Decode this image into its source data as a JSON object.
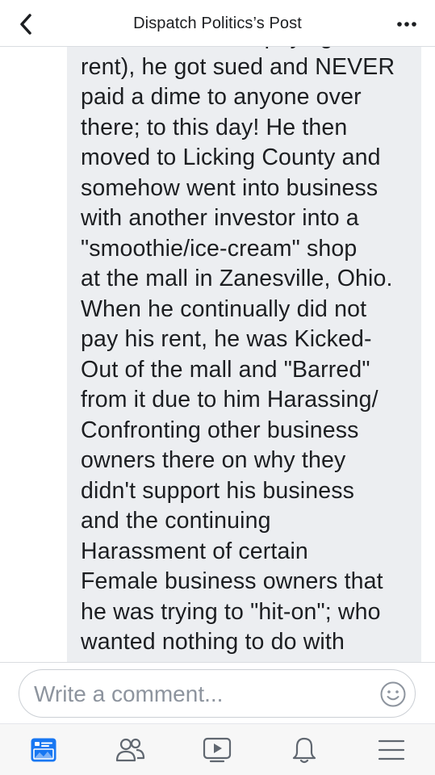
{
  "header": {
    "title": "Dispatch Politics’s Post",
    "back_icon": "chevron-left-icon",
    "more_icon": "ellipsis-icon"
  },
  "comment": {
    "text": "investors and not paying Mall\nrent), he got sued and NEVER\npaid a dime to anyone over\nthere; to this day! He then\nmoved to Licking County and\nsomehow went into business\nwith another investor into a\n\"smoothie/ice-cream\" shop\nat the mall in Zanesville, Ohio.\nWhen he continually did not\npay his rent, he was Kicked-\nOut of the mall and \"Barred\"\nfrom it due to him Harassing/\nConfronting other business\nowners there on why they\ndidn't support his business\nand the continuing\nHarassment of certain\nFemale business owners that\nhe was trying to \"hit-on\"; who\nwanted nothing to do with"
  },
  "composer": {
    "placeholder": "Write a comment...",
    "value": "",
    "emoji_icon": "smiley-icon"
  },
  "tabbar": {
    "tabs": [
      {
        "icon": "news-feed-icon",
        "active": true
      },
      {
        "icon": "friends-icon",
        "active": false
      },
      {
        "icon": "watch-icon",
        "active": false
      },
      {
        "icon": "notifications-bell-icon",
        "active": false
      },
      {
        "icon": "menu-icon",
        "active": false
      }
    ]
  },
  "colors": {
    "accent": "#1877f2",
    "text": "#1c1e21",
    "bubble": "#eceef1",
    "placeholder": "#8d949e",
    "icon_gray": "#606770"
  }
}
